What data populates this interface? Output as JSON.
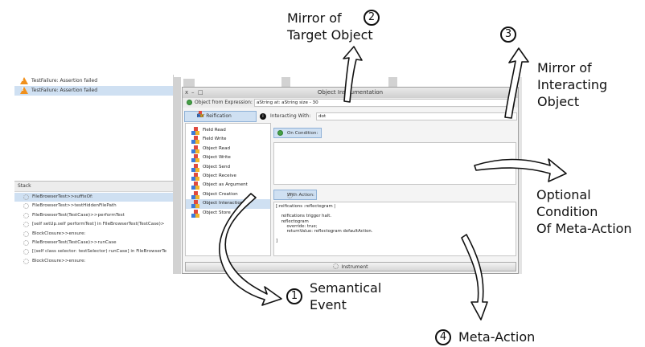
{
  "left_panel": {
    "failures": [
      "TestFailure: Assertion failed",
      "TestFailure: Assertion failed"
    ],
    "stack_header": "Stack",
    "stack_items": [
      "FileBrowserTest>>suffixOf:",
      "FileBrowserTest>>testHiddenFilePath",
      "FileBrowserTest(TestCase)>>performTest",
      "[self setUp.self performTest] in FileBrowserTest(TestCase)>",
      "BlockClosure>>ensure:",
      "FileBrowserTest(TestCase)>>runCase",
      "[(self class selector: testSelector) runCase] in FileBrowserTe",
      "BlockClosure>>ensure:"
    ]
  },
  "window": {
    "title": "Object Instrumentation",
    "close": "x",
    "minimize": "–",
    "maximize": "□",
    "menu": "▾",
    "expr_label": "Object from Expression:",
    "expr_value": "aString at: aString size - 30",
    "category_tab": "For Reification Category:",
    "interacting_badge": "i",
    "interacting_label": "Interacting With:",
    "interacting_value": "dot",
    "categories": [
      "Field Read",
      "Field Write",
      "Object Read",
      "Object Write",
      "Object Send",
      "Object Receive",
      "Object as Argument",
      "Object Creation",
      "Object Interaction",
      "Object Store"
    ],
    "selected_category_index": 8,
    "condition_tab": "On Condition:",
    "action_tab": "With Action:",
    "action_code": "[:reifications :reflectogram |\n\n    reifications trigger halt.\n    reflectogram\n        override: true;\n        returnValue: reflectogram defaultAction.\n\n]",
    "instrument_button": "Instrument"
  },
  "annotations": {
    "mirror_target": {
      "number": "2",
      "lines": [
        "Mirror of",
        "Target Object"
      ]
    },
    "mirror_interacting": {
      "number": "3",
      "lines": [
        "Mirror of",
        "Interacting",
        "Object"
      ]
    },
    "optional_condition": {
      "lines": [
        "Optional",
        "Condition",
        "Of Meta-Action"
      ]
    },
    "semantical_event": {
      "number": "1",
      "lines": [
        "Semantical",
        "Event"
      ]
    },
    "meta_action": {
      "number": "4",
      "text": "Meta-Action"
    }
  },
  "colors": {
    "selection": "#cfe0f2",
    "warning": "#f0901c",
    "green_icon": "#46a046"
  }
}
